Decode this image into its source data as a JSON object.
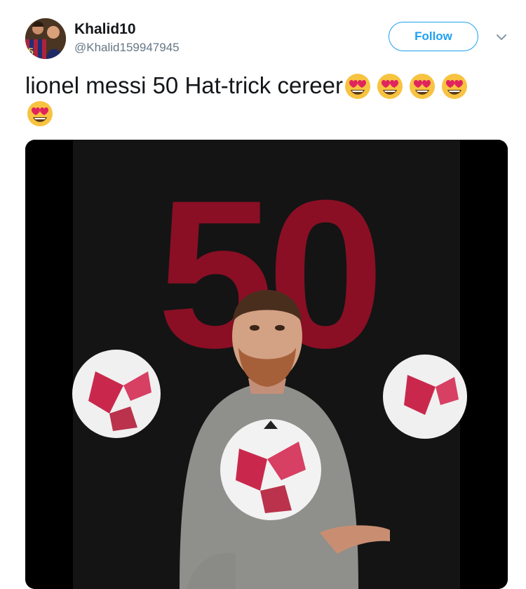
{
  "user": {
    "name": "Khalid10",
    "handle": "@Khalid159947945"
  },
  "actions": {
    "follow_label": "Follow"
  },
  "tweet": {
    "text": "lionel messi 50 Hat-trick cereer",
    "emojis": [
      "smiling-face-with-heart-eyes",
      "smiling-face-with-heart-eyes",
      "smiling-face-with-heart-eyes",
      "smiling-face-with-heart-eyes",
      "smiling-face-with-heart-eyes"
    ]
  },
  "media": {
    "big_number": "50",
    "colors": {
      "background": "#141414",
      "number": "#8a0f24",
      "accent": "#1da1f2"
    }
  }
}
